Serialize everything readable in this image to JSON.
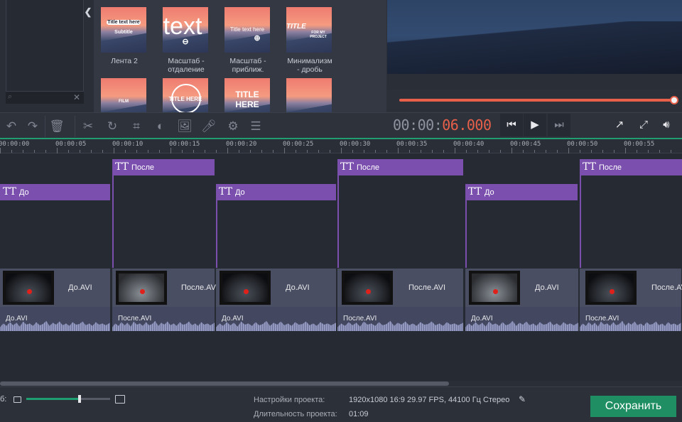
{
  "gallery": {
    "tiles": [
      {
        "caption": "Лента 2",
        "thumb_text": "Title text here",
        "thumb_sub": "Subtitle"
      },
      {
        "caption": "Масштаб - отдаление",
        "thumb_text": "text"
      },
      {
        "caption": "Масштаб - приближ.",
        "thumb_text": "Title text here"
      },
      {
        "caption": "Минимализм - дробь",
        "thumb_text": "TITLE",
        "thumb_sub": "FOR MY PROJECT"
      },
      {
        "caption": "",
        "thumb_text": "FILM"
      },
      {
        "caption": "",
        "thumb_text": "TITLE HERE"
      },
      {
        "caption": "",
        "thumb_text": "TITLE HERE"
      },
      {
        "caption": "",
        "thumb_text": ""
      }
    ]
  },
  "player": {
    "timecode_dim": "00:00:",
    "timecode_active": "06.000",
    "progress": 1.0
  },
  "ruler": {
    "ticks": [
      "00:00:00",
      "00:00:05",
      "00:00:10",
      "00:00:15",
      "00:00:20",
      "00:00:25",
      "00:00:30",
      "00:00:35",
      "00:00:40",
      "00:00:45",
      "00:00:50",
      "00:00:55"
    ]
  },
  "tracks": {
    "titles": [
      {
        "label": "До",
        "tt": "TT"
      },
      {
        "label": "После",
        "tt": "TT"
      },
      {
        "label": "До",
        "tt": "TT"
      },
      {
        "label": "После",
        "tt": "TT"
      },
      {
        "label": "До",
        "tt": "TT"
      },
      {
        "label": "После",
        "tt": "TT"
      }
    ],
    "videos": [
      {
        "label": "До.AVI"
      },
      {
        "label": "После.AVI"
      },
      {
        "label": "До.AVI"
      },
      {
        "label": "После.AVI"
      },
      {
        "label": "До.AVI"
      },
      {
        "label": "После.AVI"
      }
    ],
    "audios": [
      {
        "label": "До.AVI"
      },
      {
        "label": "После.AVI"
      },
      {
        "label": "До.AVI"
      },
      {
        "label": "После.AVI"
      },
      {
        "label": "До.AVI"
      },
      {
        "label": "После.AVI"
      }
    ]
  },
  "status": {
    "zoom_label": "б:",
    "zoom_level": 0.62,
    "settings_label": "Настройки проекта:",
    "settings_value": "1920x1080 16:9 29.97 FPS, 44100 Гц Стерео",
    "duration_label": "Длительность проекта:",
    "duration_value": "01:09",
    "save_label": "Сохранить"
  },
  "colors": {
    "accent_green": "#1f9e72",
    "timecode_red": "#e8604a",
    "title_purple": "#7a4fae"
  }
}
